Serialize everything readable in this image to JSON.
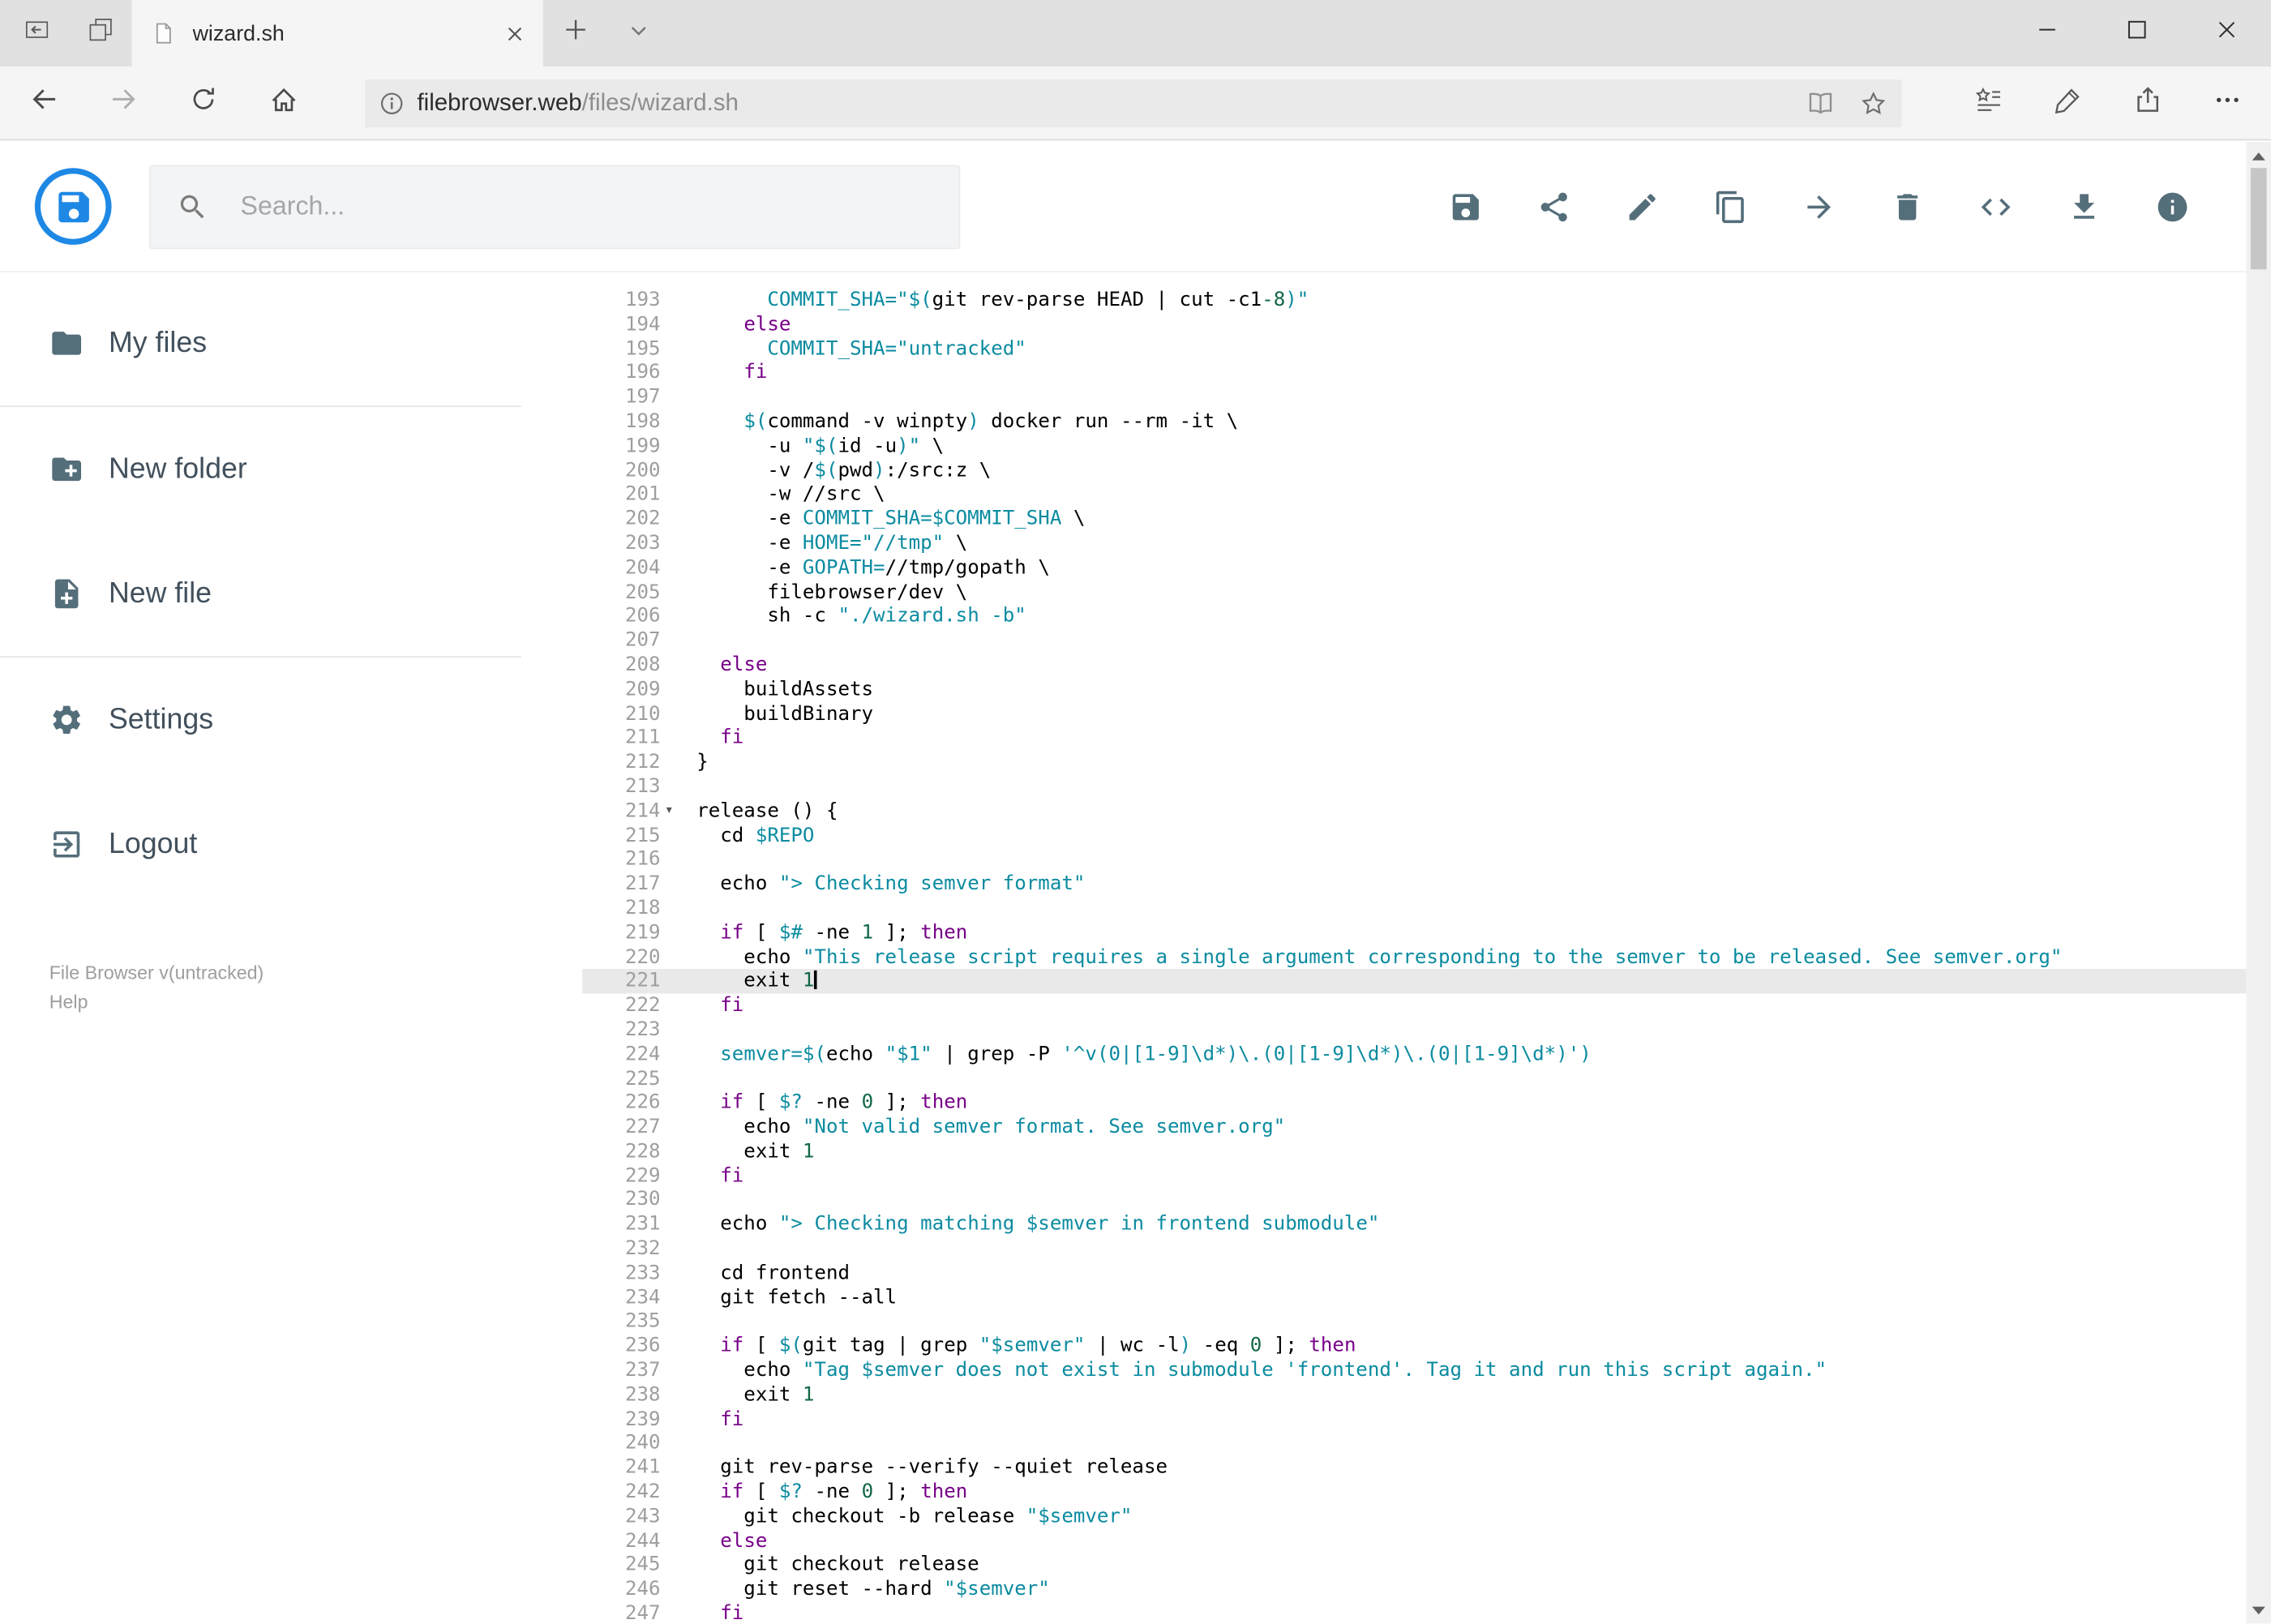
{
  "browser": {
    "tab_title": "wizard.sh",
    "url_domain": "filebrowser.web",
    "url_path": "/files/wizard.sh"
  },
  "app": {
    "search_placeholder": "Search...",
    "toolbar": [
      {
        "name": "save",
        "icon": "save"
      },
      {
        "name": "share",
        "icon": "share"
      },
      {
        "name": "rename",
        "icon": "rename"
      },
      {
        "name": "copy",
        "icon": "copy"
      },
      {
        "name": "move",
        "icon": "move"
      },
      {
        "name": "delete",
        "icon": "delete"
      },
      {
        "name": "source",
        "icon": "code"
      },
      {
        "name": "download",
        "icon": "download"
      },
      {
        "name": "info",
        "icon": "info"
      }
    ]
  },
  "sidebar": {
    "groups": [
      [
        {
          "label": "My files",
          "icon": "folder"
        }
      ],
      [
        {
          "label": "New folder",
          "icon": "create-new-folder"
        },
        {
          "label": "New file",
          "icon": "note-add"
        }
      ],
      [
        {
          "label": "Settings",
          "icon": "settings"
        },
        {
          "label": "Logout",
          "icon": "logout"
        }
      ]
    ],
    "footer_version": "File Browser v(untracked)",
    "footer_help": "Help"
  },
  "colors": {
    "accent_blue": "#1e88e5",
    "icon_gray": "#546e7a",
    "keyword": "#770088",
    "string": "#0b8ba0",
    "number": "#116644",
    "line_number": "#9e9e9e",
    "active_line_bg": "#e9e9e9"
  },
  "editor": {
    "language": "shell",
    "active_line": 221,
    "lines": [
      {
        "n": 193,
        "t": [
          [
            "p",
            "      "
          ],
          [
            "v",
            "COMMIT_SHA="
          ],
          [
            "s",
            "\"$("
          ],
          [
            "p",
            "git rev-parse HEAD | cut -c1"
          ],
          [
            "n",
            "-8"
          ],
          [
            "s",
            ")\""
          ]
        ]
      },
      {
        "n": 194,
        "t": [
          [
            "p",
            "    "
          ],
          [
            "k",
            "else"
          ]
        ]
      },
      {
        "n": 195,
        "t": [
          [
            "p",
            "      "
          ],
          [
            "v",
            "COMMIT_SHA="
          ],
          [
            "s",
            "\"untracked\""
          ]
        ]
      },
      {
        "n": 196,
        "t": [
          [
            "p",
            "    "
          ],
          [
            "k",
            "fi"
          ]
        ]
      },
      {
        "n": 197,
        "t": []
      },
      {
        "n": 198,
        "t": [
          [
            "p",
            "    "
          ],
          [
            "s",
            "$("
          ],
          [
            "p",
            "command -v winpty"
          ],
          [
            "s",
            ")"
          ],
          [
            "p",
            " docker run --rm -it \\"
          ]
        ]
      },
      {
        "n": 199,
        "t": [
          [
            "p",
            "      -u "
          ],
          [
            "s",
            "\"$("
          ],
          [
            "p",
            "id -u"
          ],
          [
            "s",
            ")\""
          ],
          [
            "p",
            " \\"
          ]
        ]
      },
      {
        "n": 200,
        "t": [
          [
            "p",
            "      -v /"
          ],
          [
            "s",
            "$("
          ],
          [
            "p",
            "pwd"
          ],
          [
            "s",
            ")"
          ],
          [
            "p",
            ":/src:z \\"
          ]
        ]
      },
      {
        "n": 201,
        "t": [
          [
            "p",
            "      -w //src \\"
          ]
        ]
      },
      {
        "n": 202,
        "t": [
          [
            "p",
            "      -e "
          ],
          [
            "v",
            "COMMIT_SHA=$COMMIT_SHA"
          ],
          [
            "p",
            " \\"
          ]
        ]
      },
      {
        "n": 203,
        "t": [
          [
            "p",
            "      -e "
          ],
          [
            "v",
            "HOME="
          ],
          [
            "s",
            "\"//tmp\""
          ],
          [
            "p",
            " \\"
          ]
        ]
      },
      {
        "n": 204,
        "t": [
          [
            "p",
            "      -e "
          ],
          [
            "v",
            "GOPATH="
          ],
          [
            "p",
            "//tmp/gopath \\"
          ]
        ]
      },
      {
        "n": 205,
        "t": [
          [
            "p",
            "      filebrowser/dev \\"
          ]
        ]
      },
      {
        "n": 206,
        "t": [
          [
            "p",
            "      sh -c "
          ],
          [
            "s",
            "\"./wizard.sh -b\""
          ]
        ]
      },
      {
        "n": 207,
        "t": []
      },
      {
        "n": 208,
        "t": [
          [
            "p",
            "  "
          ],
          [
            "k",
            "else"
          ]
        ]
      },
      {
        "n": 209,
        "t": [
          [
            "p",
            "    buildAssets"
          ]
        ]
      },
      {
        "n": 210,
        "t": [
          [
            "p",
            "    buildBinary"
          ]
        ]
      },
      {
        "n": 211,
        "t": [
          [
            "p",
            "  "
          ],
          [
            "k",
            "fi"
          ]
        ]
      },
      {
        "n": 212,
        "t": [
          [
            "p",
            "}"
          ]
        ]
      },
      {
        "n": 213,
        "t": []
      },
      {
        "n": 214,
        "fold": true,
        "t": [
          [
            "p",
            "release () {"
          ]
        ]
      },
      {
        "n": 215,
        "t": [
          [
            "p",
            "  cd "
          ],
          [
            "v",
            "$REPO"
          ]
        ]
      },
      {
        "n": 216,
        "t": []
      },
      {
        "n": 217,
        "t": [
          [
            "p",
            "  echo "
          ],
          [
            "s",
            "\"> Checking semver format\""
          ]
        ]
      },
      {
        "n": 218,
        "t": []
      },
      {
        "n": 219,
        "t": [
          [
            "p",
            "  "
          ],
          [
            "k",
            "if"
          ],
          [
            "p",
            " [ "
          ],
          [
            "v",
            "$#"
          ],
          [
            "p",
            " -ne "
          ],
          [
            "n",
            "1"
          ],
          [
            "p",
            " ]; "
          ],
          [
            "k",
            "then"
          ]
        ]
      },
      {
        "n": 220,
        "t": [
          [
            "p",
            "    echo "
          ],
          [
            "s",
            "\"This release script requires a single argument corresponding to the semver to be released. See semver.org\""
          ]
        ]
      },
      {
        "n": 221,
        "cursor": true,
        "t": [
          [
            "p",
            "    exit "
          ],
          [
            "n",
            "1"
          ]
        ]
      },
      {
        "n": 222,
        "t": [
          [
            "p",
            "  "
          ],
          [
            "k",
            "fi"
          ]
        ]
      },
      {
        "n": 223,
        "t": []
      },
      {
        "n": 224,
        "t": [
          [
            "p",
            "  "
          ],
          [
            "v",
            "semver="
          ],
          [
            "s",
            "$("
          ],
          [
            "p",
            "echo "
          ],
          [
            "s",
            "\"$1\""
          ],
          [
            "p",
            " | grep -P "
          ],
          [
            "s",
            "'^v(0|[1-9]\\d*)\\.(0|[1-9]\\d*)\\.(0|[1-9]\\d*)'"
          ],
          [
            "s",
            ")"
          ]
        ]
      },
      {
        "n": 225,
        "t": []
      },
      {
        "n": 226,
        "t": [
          [
            "p",
            "  "
          ],
          [
            "k",
            "if"
          ],
          [
            "p",
            " [ "
          ],
          [
            "v",
            "$?"
          ],
          [
            "p",
            " -ne "
          ],
          [
            "n",
            "0"
          ],
          [
            "p",
            " ]; "
          ],
          [
            "k",
            "then"
          ]
        ]
      },
      {
        "n": 227,
        "t": [
          [
            "p",
            "    echo "
          ],
          [
            "s",
            "\"Not valid semver format. See semver.org\""
          ]
        ]
      },
      {
        "n": 228,
        "t": [
          [
            "p",
            "    exit "
          ],
          [
            "n",
            "1"
          ]
        ]
      },
      {
        "n": 229,
        "t": [
          [
            "p",
            "  "
          ],
          [
            "k",
            "fi"
          ]
        ]
      },
      {
        "n": 230,
        "t": []
      },
      {
        "n": 231,
        "t": [
          [
            "p",
            "  echo "
          ],
          [
            "s",
            "\"> Checking matching $semver in frontend submodule\""
          ]
        ]
      },
      {
        "n": 232,
        "t": []
      },
      {
        "n": 233,
        "t": [
          [
            "p",
            "  cd frontend"
          ]
        ]
      },
      {
        "n": 234,
        "t": [
          [
            "p",
            "  git fetch --all"
          ]
        ]
      },
      {
        "n": 235,
        "t": []
      },
      {
        "n": 236,
        "t": [
          [
            "p",
            "  "
          ],
          [
            "k",
            "if"
          ],
          [
            "p",
            " [ "
          ],
          [
            "s",
            "$("
          ],
          [
            "p",
            "git tag | grep "
          ],
          [
            "s",
            "\"$semver\""
          ],
          [
            "p",
            " | wc -l"
          ],
          [
            "s",
            ")"
          ],
          [
            "p",
            " -eq "
          ],
          [
            "n",
            "0"
          ],
          [
            "p",
            " ]; "
          ],
          [
            "k",
            "then"
          ]
        ]
      },
      {
        "n": 237,
        "t": [
          [
            "p",
            "    echo "
          ],
          [
            "s",
            "\"Tag $semver does not exist in submodule 'frontend'. Tag it and run this script again.\""
          ]
        ]
      },
      {
        "n": 238,
        "t": [
          [
            "p",
            "    exit "
          ],
          [
            "n",
            "1"
          ]
        ]
      },
      {
        "n": 239,
        "t": [
          [
            "p",
            "  "
          ],
          [
            "k",
            "fi"
          ]
        ]
      },
      {
        "n": 240,
        "t": []
      },
      {
        "n": 241,
        "t": [
          [
            "p",
            "  git rev-parse --verify --quiet release"
          ]
        ]
      },
      {
        "n": 242,
        "t": [
          [
            "p",
            "  "
          ],
          [
            "k",
            "if"
          ],
          [
            "p",
            " [ "
          ],
          [
            "v",
            "$?"
          ],
          [
            "p",
            " -ne "
          ],
          [
            "n",
            "0"
          ],
          [
            "p",
            " ]; "
          ],
          [
            "k",
            "then"
          ]
        ]
      },
      {
        "n": 243,
        "t": [
          [
            "p",
            "    git checkout -b release "
          ],
          [
            "s",
            "\"$semver\""
          ]
        ]
      },
      {
        "n": 244,
        "t": [
          [
            "p",
            "  "
          ],
          [
            "k",
            "else"
          ]
        ]
      },
      {
        "n": 245,
        "t": [
          [
            "p",
            "    git checkout release"
          ]
        ]
      },
      {
        "n": 246,
        "t": [
          [
            "p",
            "    git reset --hard "
          ],
          [
            "s",
            "\"$semver\""
          ]
        ]
      },
      {
        "n": 247,
        "t": [
          [
            "p",
            "  "
          ],
          [
            "k",
            "fi"
          ]
        ]
      }
    ]
  }
}
